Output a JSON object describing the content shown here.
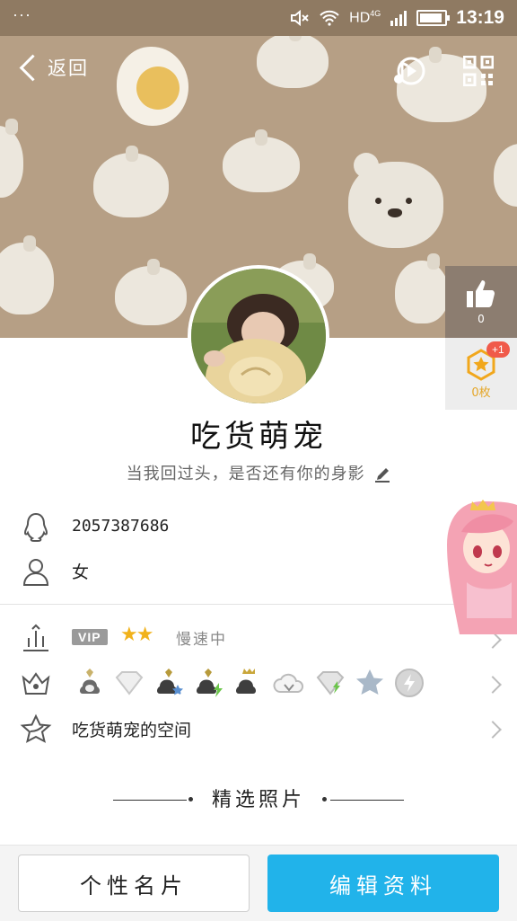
{
  "status_bar": {
    "menu_dots": "···",
    "network": "HD",
    "network_sub": "4G",
    "time": "13:19"
  },
  "nav": {
    "back_label": "返回"
  },
  "side_panel": {
    "like_count": "0",
    "badge_plus": "+1",
    "badge_count": "0枚"
  },
  "profile": {
    "nickname": "吃货萌宠",
    "signature": "当我回过头，是否还有你的身影",
    "qq_number": "2057387686",
    "gender": "女"
  },
  "vip_row": {
    "vip_label": "VIP",
    "stars": "★★",
    "speed_text": "慢速中"
  },
  "space_row": {
    "label": "吃货萌宠的空间"
  },
  "photos": {
    "title": "精选照片"
  },
  "bottom": {
    "card_label": "个性名片",
    "edit_label": "编辑资料"
  },
  "colors": {
    "accent": "#21b3ea",
    "cover": "#b69f85",
    "star": "#f1b21b",
    "badge_red": "#f05a4a"
  }
}
